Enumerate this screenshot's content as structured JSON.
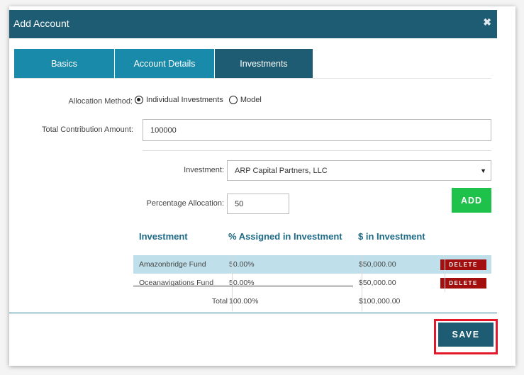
{
  "dialog": {
    "title": "Add Account",
    "close_glyph": "✖"
  },
  "tabs": [
    {
      "label": "Basics"
    },
    {
      "label": "Account Details"
    },
    {
      "label": "Investments"
    }
  ],
  "form": {
    "allocation_label": "Allocation Method:",
    "allocation_options": [
      "Individual Investments",
      "Model"
    ],
    "allocation_selected": "Individual Investments",
    "total_label": "Total Contribution Amount:",
    "total_value": "100000",
    "investment_label": "Investment:",
    "investment_value": "ARP Capital Partners, LLC",
    "percentage_label": "Percentage Allocation:",
    "percentage_value": "50",
    "add_label": "ADD"
  },
  "table": {
    "headers": [
      "Investment",
      "% Assigned in Investment",
      "$ in Investment"
    ],
    "rows": [
      {
        "investment": "Amazonbridge Fund",
        "percent": "50.00%",
        "amount": "$50,000.00",
        "action": "DELETE"
      },
      {
        "investment": "Oceanavigations Fund",
        "percent": "50.00%",
        "amount": "$50,000.00",
        "action": "DELETE"
      }
    ],
    "total": {
      "label": "Total",
      "percent": "100.00%",
      "amount": "$100,000.00"
    }
  },
  "footer": {
    "save_label": "SAVE"
  },
  "colors": {
    "header": "#1e5c74",
    "tab": "#1a8aaa",
    "add": "#1ec24a",
    "delete": "#a30e0e",
    "highlight": "#e3182a"
  }
}
